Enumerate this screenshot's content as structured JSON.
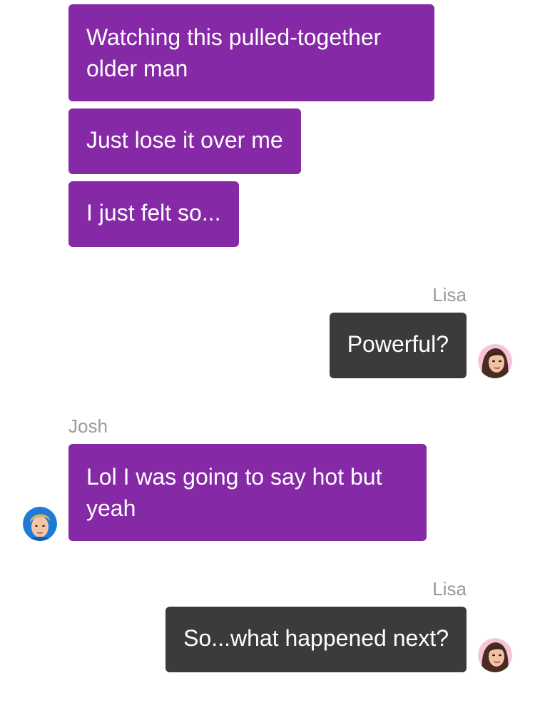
{
  "conversation": {
    "messages": [
      {
        "sender": "",
        "text": "Watching this pulled-together older man"
      },
      {
        "sender": "",
        "text": "Just lose it over me"
      },
      {
        "sender": "",
        "text": "I just felt so..."
      },
      {
        "sender": "Lisa",
        "text": "Powerful?"
      },
      {
        "sender": "Josh",
        "text": "Lol I was going to say hot but yeah"
      },
      {
        "sender": "Lisa",
        "text": "So...what happened next?"
      }
    ]
  },
  "participants": {
    "lisa": {
      "name": "Lisa",
      "avatar_icon": "lisa-avatar-icon"
    },
    "josh": {
      "name": "Josh",
      "avatar_icon": "josh-avatar-icon"
    }
  },
  "colors": {
    "incoming_bubble": "#8629a6",
    "outgoing_bubble": "#3b3b3b",
    "sender_label": "#9a9a9a",
    "background": "#ffffff"
  }
}
